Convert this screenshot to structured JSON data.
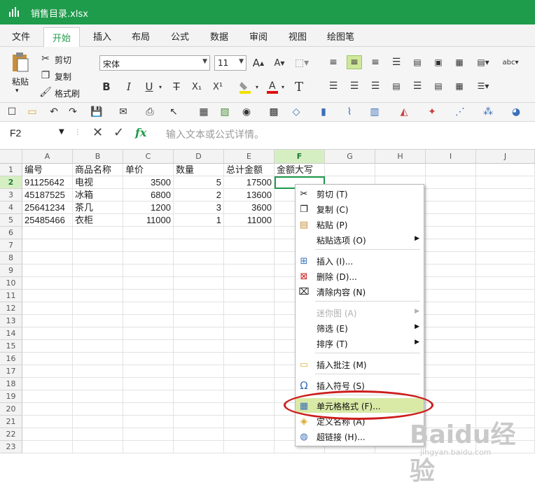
{
  "window": {
    "title": "销售目录.xlsx"
  },
  "menu": {
    "tabs": [
      "文件",
      "开始",
      "插入",
      "布局",
      "公式",
      "数据",
      "审阅",
      "视图",
      "绘图笔"
    ],
    "active": "开始"
  },
  "ribbon": {
    "paste": "粘贴",
    "cut": "剪切",
    "copy": "复制",
    "format_painter": "格式刷",
    "font_name": "宋体",
    "font_size": "11",
    "bold": "B",
    "italic": "I",
    "underline": "U",
    "strike": "T",
    "subscript": "X₁",
    "superscript": "X¹"
  },
  "formula_bar": {
    "cell_ref": "F2",
    "fx": "fx",
    "placeholder": "输入文本或公式详情。"
  },
  "sheet": {
    "columns": [
      "A",
      "B",
      "C",
      "D",
      "E",
      "F",
      "G",
      "H",
      "I",
      "J"
    ],
    "selected_column": "F",
    "rows": [
      "1",
      "2",
      "3",
      "4",
      "5",
      "6",
      "7",
      "8",
      "9",
      "10",
      "11",
      "12",
      "13",
      "14",
      "15",
      "16",
      "17",
      "18",
      "19",
      "20",
      "21",
      "22",
      "23"
    ],
    "selected_row": "2",
    "cells": [
      [
        "编号",
        "商品名称",
        "单价",
        "数量",
        "总计金额",
        "金额大写"
      ],
      [
        "91125642",
        "电视",
        "3500",
        "5",
        "17500",
        ""
      ],
      [
        "45187525",
        "冰箱",
        "6800",
        "2",
        "13600",
        ""
      ],
      [
        "25641234",
        "茶几",
        "1200",
        "3",
        "3600",
        ""
      ],
      [
        "25485466",
        "衣柜",
        "11000",
        "1",
        "11000",
        ""
      ]
    ]
  },
  "context_menu": {
    "items": [
      {
        "label": "剪切 (T)",
        "icon": "scissors-icon"
      },
      {
        "label": "复制 (C)",
        "icon": "copy-icon"
      },
      {
        "label": "粘贴 (P)",
        "icon": "paste-icon"
      },
      {
        "label": "粘贴选项 (O)",
        "icon": ""
      },
      {
        "label": "插入 (I)...",
        "icon": "insert-row-icon"
      },
      {
        "label": "删除 (D)...",
        "icon": "delete-row-icon"
      },
      {
        "label": "清除内容 (N)",
        "icon": "clear-icon"
      },
      {
        "label": "迷你图 (A)",
        "icon": ""
      },
      {
        "label": "筛选 (E)",
        "icon": ""
      },
      {
        "label": "排序 (T)",
        "icon": ""
      },
      {
        "label": "插入批注 (M)",
        "icon": "comment-icon"
      },
      {
        "label": "插入符号 (S)",
        "icon": "omega-icon"
      },
      {
        "label": "单元格格式 (F)...",
        "icon": "format-cells-icon"
      },
      {
        "label": "定义名称 (A)",
        "icon": "tag-icon"
      },
      {
        "label": "超链接 (H)...",
        "icon": "globe-link-icon"
      }
    ]
  },
  "watermark": {
    "text": "Baidu经验",
    "sub": "jingyan.baidu.com"
  },
  "colors": {
    "brand_green": "#1e9b4b",
    "highlight": "#d9eaa7",
    "annotation_red": "#cc1d1d"
  }
}
